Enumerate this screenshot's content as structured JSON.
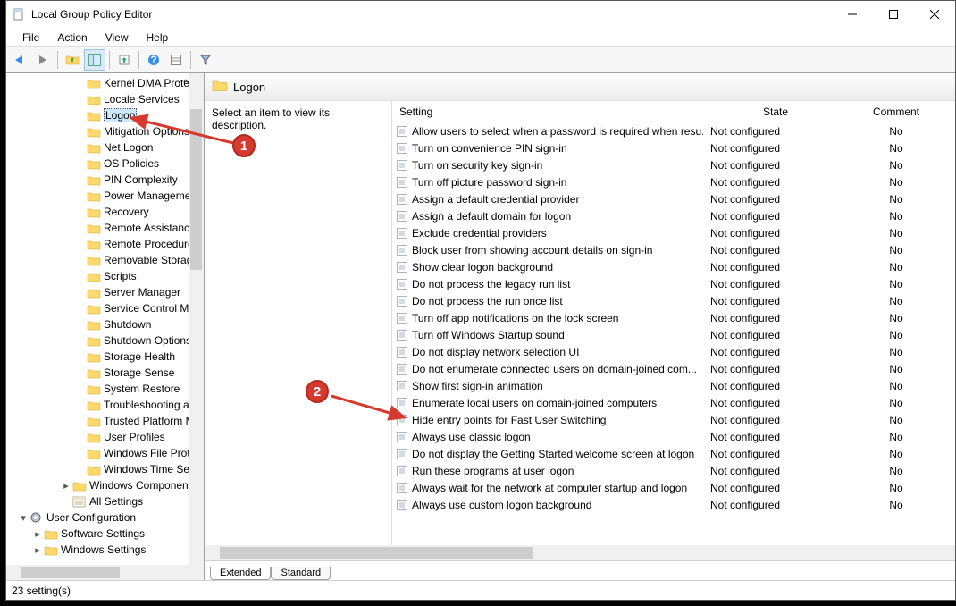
{
  "window_title": "Local Group Policy Editor",
  "menu": [
    "File",
    "Action",
    "View",
    "Help"
  ],
  "tree_items": [
    {
      "ind": 76,
      "exp": "",
      "t": "f",
      "label": "Kernel DMA Protect",
      "sel": false,
      "scroll": "^"
    },
    {
      "ind": 76,
      "exp": "",
      "t": "f",
      "label": "Locale Services",
      "sel": false
    },
    {
      "ind": 76,
      "exp": "",
      "t": "f",
      "label": "Logon",
      "sel": true
    },
    {
      "ind": 76,
      "exp": "",
      "t": "f",
      "label": "Mitigation Options",
      "sel": false
    },
    {
      "ind": 76,
      "exp": "",
      "t": "f",
      "label": "Net Logon",
      "sel": false
    },
    {
      "ind": 76,
      "exp": "",
      "t": "f",
      "label": "OS Policies",
      "sel": false
    },
    {
      "ind": 76,
      "exp": "",
      "t": "f",
      "label": "PIN Complexity",
      "sel": false
    },
    {
      "ind": 76,
      "exp": "",
      "t": "f",
      "label": "Power Management",
      "sel": false
    },
    {
      "ind": 76,
      "exp": "",
      "t": "f",
      "label": "Recovery",
      "sel": false
    },
    {
      "ind": 76,
      "exp": "",
      "t": "f",
      "label": "Remote Assistance",
      "sel": false
    },
    {
      "ind": 76,
      "exp": "",
      "t": "f",
      "label": "Remote Procedure (",
      "sel": false
    },
    {
      "ind": 76,
      "exp": "",
      "t": "f",
      "label": "Removable Storage",
      "sel": false
    },
    {
      "ind": 76,
      "exp": "",
      "t": "f",
      "label": "Scripts",
      "sel": false
    },
    {
      "ind": 76,
      "exp": "",
      "t": "f",
      "label": "Server Manager",
      "sel": false
    },
    {
      "ind": 76,
      "exp": "",
      "t": "f",
      "label": "Service Control Man",
      "sel": false
    },
    {
      "ind": 76,
      "exp": "",
      "t": "f",
      "label": "Shutdown",
      "sel": false
    },
    {
      "ind": 76,
      "exp": "",
      "t": "f",
      "label": "Shutdown Options",
      "sel": false
    },
    {
      "ind": 76,
      "exp": "",
      "t": "f",
      "label": "Storage Health",
      "sel": false
    },
    {
      "ind": 76,
      "exp": "",
      "t": "f",
      "label": "Storage Sense",
      "sel": false
    },
    {
      "ind": 76,
      "exp": "",
      "t": "f",
      "label": "System Restore",
      "sel": false
    },
    {
      "ind": 76,
      "exp": "",
      "t": "f",
      "label": "Troubleshooting an",
      "sel": false
    },
    {
      "ind": 76,
      "exp": "",
      "t": "f",
      "label": "Trusted Platform M",
      "sel": false
    },
    {
      "ind": 76,
      "exp": "",
      "t": "f",
      "label": "User Profiles",
      "sel": false
    },
    {
      "ind": 76,
      "exp": "",
      "t": "f",
      "label": "Windows File Protec",
      "sel": false
    },
    {
      "ind": 76,
      "exp": "",
      "t": "f",
      "label": "Windows Time Serv",
      "sel": false
    },
    {
      "ind": 60,
      "exp": ">",
      "t": "f",
      "label": "Windows Components",
      "sel": false
    },
    {
      "ind": 60,
      "exp": "",
      "t": "s",
      "label": "All Settings",
      "sel": false
    },
    {
      "ind": 12,
      "exp": "v",
      "t": "c",
      "label": "User Configuration",
      "sel": false
    },
    {
      "ind": 28,
      "exp": ">",
      "t": "f",
      "label": "Software Settings",
      "sel": false
    },
    {
      "ind": 28,
      "exp": ">",
      "t": "f",
      "label": "Windows Settings",
      "sel": false
    }
  ],
  "pane_title": "Logon",
  "desc_text": "Select an item to view its description.",
  "columns": {
    "setting": "Setting",
    "state": "State",
    "comment": "Comment"
  },
  "rows": [
    {
      "s": "Allow users to select when a password is required when resu...",
      "st": "Not configured",
      "c": "No"
    },
    {
      "s": "Turn on convenience PIN sign-in",
      "st": "Not configured",
      "c": "No"
    },
    {
      "s": "Turn on security key sign-in",
      "st": "Not configured",
      "c": "No"
    },
    {
      "s": "Turn off picture password sign-in",
      "st": "Not configured",
      "c": "No"
    },
    {
      "s": "Assign a default credential provider",
      "st": "Not configured",
      "c": "No"
    },
    {
      "s": "Assign a default domain for logon",
      "st": "Not configured",
      "c": "No"
    },
    {
      "s": "Exclude credential providers",
      "st": "Not configured",
      "c": "No"
    },
    {
      "s": "Block user from showing account details on sign-in",
      "st": "Not configured",
      "c": "No"
    },
    {
      "s": "Show clear logon background",
      "st": "Not configured",
      "c": "No"
    },
    {
      "s": "Do not process the legacy run list",
      "st": "Not configured",
      "c": "No"
    },
    {
      "s": "Do not process the run once list",
      "st": "Not configured",
      "c": "No"
    },
    {
      "s": "Turn off app notifications on the lock screen",
      "st": "Not configured",
      "c": "No"
    },
    {
      "s": "Turn off Windows Startup sound",
      "st": "Not configured",
      "c": "No"
    },
    {
      "s": "Do not display network selection UI",
      "st": "Not configured",
      "c": "No"
    },
    {
      "s": "Do not enumerate connected users on domain-joined com...",
      "st": "Not configured",
      "c": "No"
    },
    {
      "s": "Show first sign-in animation",
      "st": "Not configured",
      "c": "No"
    },
    {
      "s": "Enumerate local users on domain-joined computers",
      "st": "Not configured",
      "c": "No"
    },
    {
      "s": "Hide entry points for Fast User Switching",
      "st": "Not configured",
      "c": "No"
    },
    {
      "s": "Always use classic logon",
      "st": "Not configured",
      "c": "No"
    },
    {
      "s": "Do not display the Getting Started welcome screen at logon",
      "st": "Not configured",
      "c": "No"
    },
    {
      "s": "Run these programs at user logon",
      "st": "Not configured",
      "c": "No"
    },
    {
      "s": "Always wait for the network at computer startup and logon",
      "st": "Not configured",
      "c": "No"
    },
    {
      "s": "Always use custom logon background",
      "st": "Not configured",
      "c": "No"
    }
  ],
  "tabs": {
    "extended": "Extended",
    "standard": "Standard"
  },
  "status": "23 setting(s)",
  "callouts": {
    "b1": "1",
    "b2": "2"
  }
}
